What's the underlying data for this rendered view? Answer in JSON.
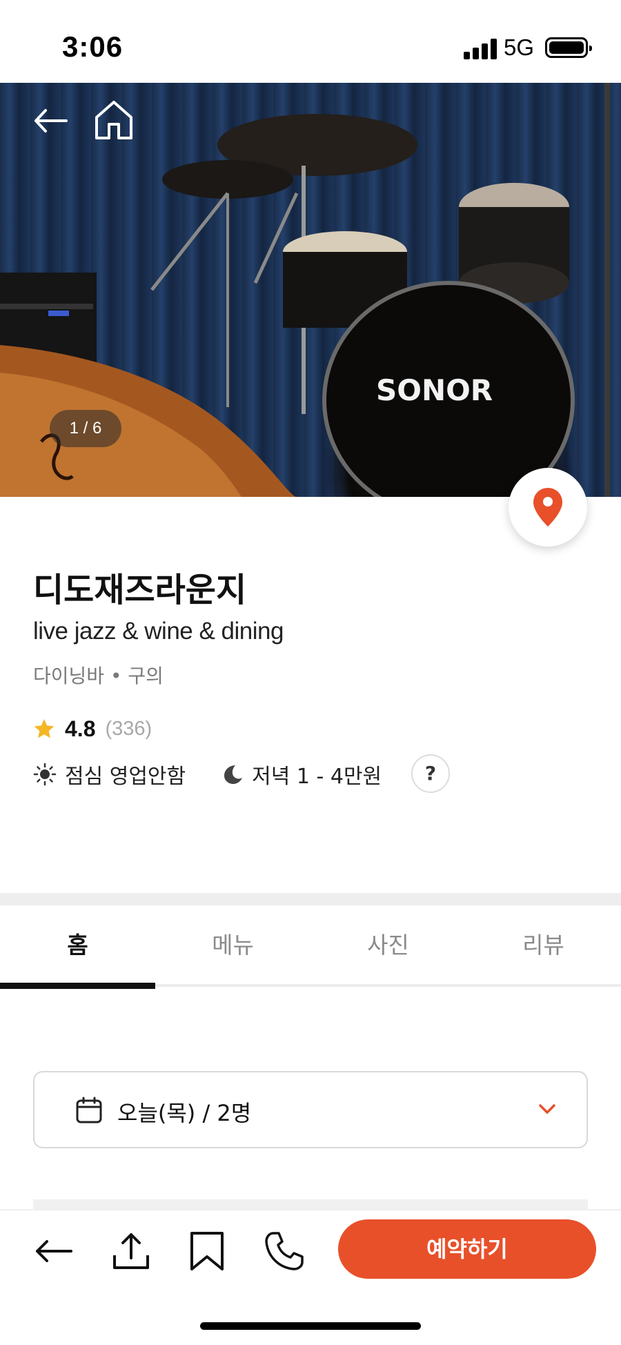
{
  "status_bar": {
    "time": "3:06",
    "network": "5G"
  },
  "hero": {
    "image_counter": "1 / 6",
    "drum_brand": "SONOR"
  },
  "restaurant": {
    "name": "디도재즈라운지",
    "tagline": "live jazz & wine & dining",
    "category": "다이닝바 • 구의",
    "rating": "4.8",
    "review_count": "(336)",
    "lunch": "점심 영업안함",
    "dinner": "저녁 1 - 4만원",
    "help": "?"
  },
  "tabs": [
    {
      "label": "홈",
      "active": true
    },
    {
      "label": "메뉴",
      "active": false
    },
    {
      "label": "사진",
      "active": false
    },
    {
      "label": "리뷰",
      "active": false
    }
  ],
  "date_selector": {
    "value": "오늘(목) / 2명"
  },
  "bottom_bar": {
    "reserve_label": "예약하기"
  },
  "colors": {
    "accent": "#e8502a",
    "star": "#f5b625",
    "text_muted": "#7a7a7a"
  },
  "icons": [
    "back-arrow-icon",
    "home-icon",
    "map-pin-icon",
    "star-icon",
    "sun-icon",
    "moon-icon",
    "calendar-icon",
    "chevron-down-icon",
    "share-icon",
    "bookmark-icon",
    "phone-icon"
  ]
}
